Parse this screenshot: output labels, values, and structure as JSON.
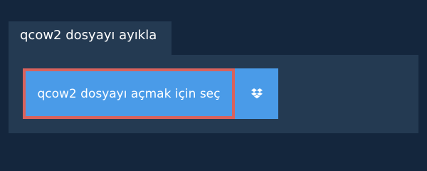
{
  "tab": {
    "label": "qcow2 dosyayı ayıkla"
  },
  "upload": {
    "select_label": "qcow2 dosyayı açmak için seç",
    "dropbox_icon": "dropbox-icon"
  },
  "colors": {
    "background": "#14263d",
    "panel": "#243a52",
    "button": "#4a9be8",
    "highlight_border": "#d9625c",
    "text": "#ffffff"
  }
}
